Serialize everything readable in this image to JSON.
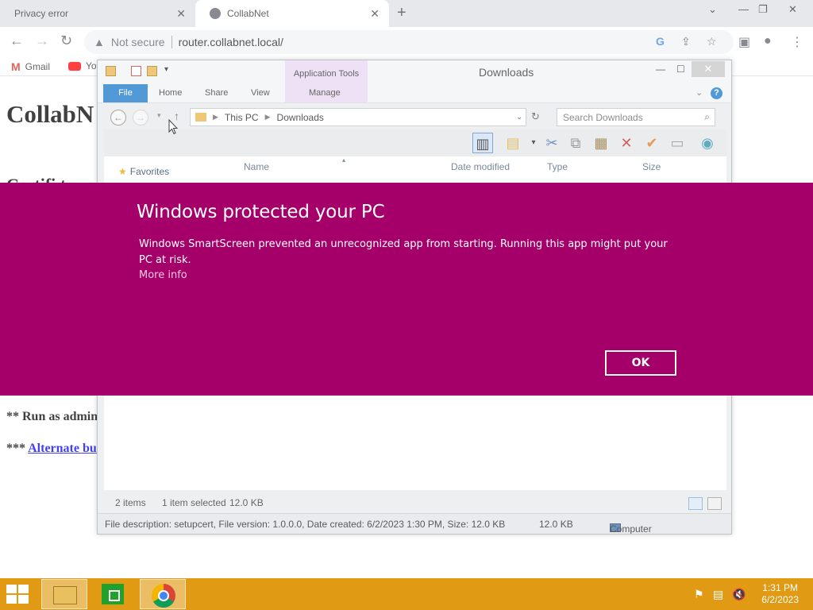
{
  "browser": {
    "tabs": [
      {
        "title": "Privacy error",
        "close": "✕"
      },
      {
        "title": "CollabNet",
        "close": "✕"
      }
    ],
    "new_tab": "+",
    "not_secure": "Not secure",
    "url": "router.collabnet.local/",
    "bookmarks": [
      {
        "label": "Gmail"
      },
      {
        "label": "Yo"
      }
    ]
  },
  "webpage": {
    "title": "CollabN",
    "heading": "Certifi t",
    "line1": "** Run as admin",
    "line2_prefix": "*** ",
    "line2_link": "Alternate bu"
  },
  "explorer": {
    "title": "Downloads",
    "contextual_tab": "Application Tools",
    "ribbon_tabs": [
      "File",
      "Home",
      "Share",
      "View",
      "Manage"
    ],
    "breadcrumb": [
      "This PC",
      "Downloads"
    ],
    "search_placeholder": "Search Downloads",
    "columns": [
      "Name",
      "Date modified",
      "Type",
      "Size"
    ],
    "sidebar_favorites": "Favorites",
    "status": {
      "item_count": "2 items",
      "selection": "1 item selected",
      "selection_size": "12.0 KB"
    },
    "details": {
      "description": "File description: setupcert, File version: 1.0.0.0, Date created: 6/2/2023 1:30 PM, Size: 12.0 KB",
      "size": "12.0 KB",
      "location": "Computer"
    }
  },
  "smartscreen": {
    "title": "Windows protected your PC",
    "message": "Windows SmartScreen prevented an unrecognized app from starting. Running this app might put your PC at risk.",
    "more_info": "More info",
    "ok_label": "OK",
    "background_color": "#a5006a"
  },
  "taskbar": {
    "time": "1:31 PM",
    "date": "6/2/2023",
    "color": "#e19a13"
  }
}
